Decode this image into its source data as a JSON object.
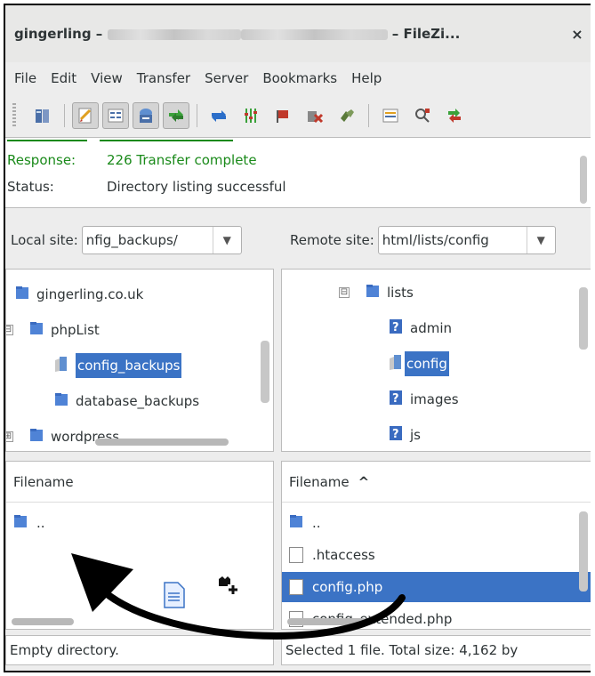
{
  "window": {
    "title_prefix": "gingerling – ",
    "title_suffix": " – FileZi...",
    "close_label": "×"
  },
  "menu": [
    "File",
    "Edit",
    "View",
    "Transfer",
    "Server",
    "Bookmarks",
    "Help"
  ],
  "log": {
    "lines": [
      {
        "label": "Response:",
        "text": "226 Transfer complete",
        "color": "#1a8a1a"
      },
      {
        "label": "Status:",
        "text": "Directory listing successful",
        "color": "#2e3436"
      }
    ]
  },
  "local": {
    "site_label": "Local site:",
    "site_value": "nfig_backups/",
    "tree": [
      {
        "label": "gingerling.co.uk"
      },
      {
        "label": "phpList",
        "expander": "⊟"
      },
      {
        "label": "config_backups",
        "selected": true
      },
      {
        "label": "database_backups"
      },
      {
        "label": "wordpress",
        "expander": "⊞"
      }
    ],
    "list_header": "Filename",
    "files": [
      ".."
    ],
    "status": "Empty directory."
  },
  "remote": {
    "site_label": "Remote site:",
    "site_value": "html/lists/config",
    "tree": [
      {
        "label": "lists",
        "expander": "⊟"
      },
      {
        "label": "admin"
      },
      {
        "label": "config",
        "selected": true
      },
      {
        "label": "images"
      },
      {
        "label": "js"
      }
    ],
    "list_header": "Filename",
    "sort_indicator": "^",
    "files": [
      {
        "name": ".."
      },
      {
        "name": ".htaccess"
      },
      {
        "name": "config.php",
        "selected": true
      },
      {
        "name": "config_extended.php"
      }
    ],
    "status": "Selected 1 file. Total size: 4,162 by"
  },
  "colors": {
    "selection": "#3b73c5",
    "log_response": "#1a8a1a",
    "arrow": "#000000"
  }
}
